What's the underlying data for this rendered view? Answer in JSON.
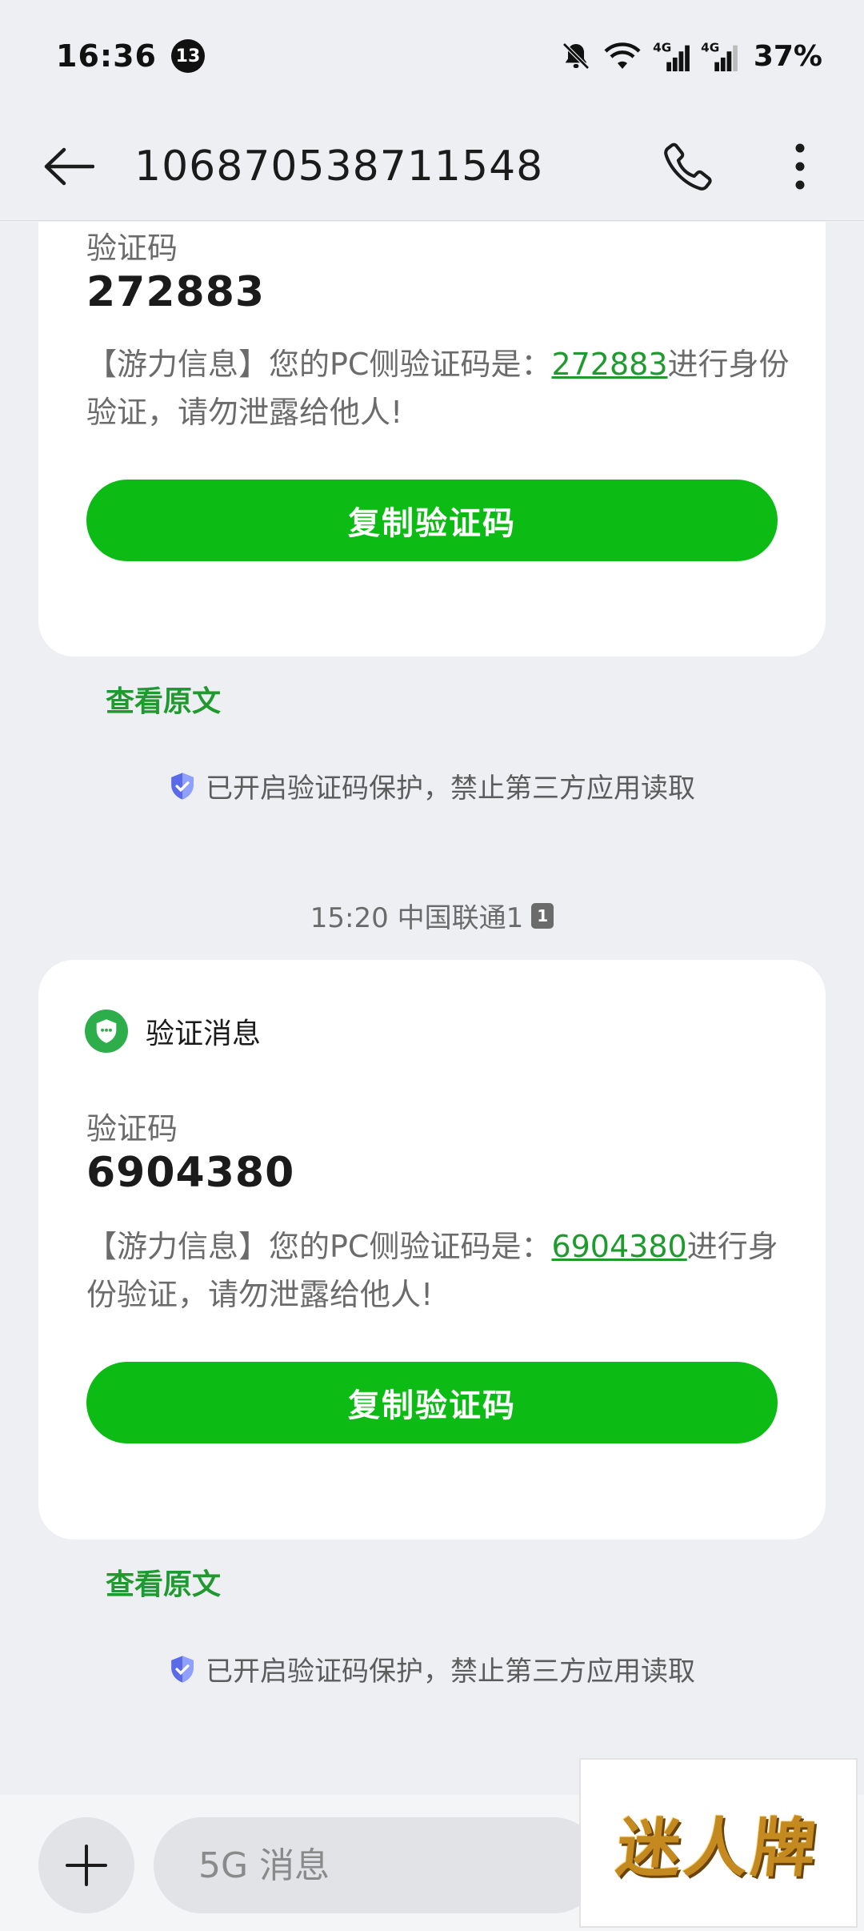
{
  "status_bar": {
    "time": "16:36",
    "notification_count": "13",
    "network_1": "4G",
    "network_2": "4G",
    "battery": "37%"
  },
  "header": {
    "title": "106870538711548"
  },
  "messages": [
    {
      "label": "验证码",
      "code": "272883",
      "text_before": "【游力信息】您的PC侧验证码是：",
      "text_code": "272883",
      "text_after": "进行身份验证，请勿泄露给他人!",
      "copy_label": "复制验证码",
      "view_original": "查看原文",
      "protection": "已开启验证码保护，禁止第三方应用读取"
    },
    {
      "timestamp": "15:20 中国联通1",
      "sim": "1",
      "card_title": "验证消息",
      "label": "验证码",
      "code": "6904380",
      "text_before": "【游力信息】您的PC侧验证码是：",
      "text_code": "6904380",
      "text_after": "进行身份验证，请勿泄露给他人!",
      "copy_label": "复制验证码",
      "view_original": "查看原文",
      "protection": "已开启验证码保护，禁止第三方应用读取"
    }
  ],
  "composer": {
    "placeholder": "5G 消息"
  },
  "watermark": {
    "text": "迷人牌"
  },
  "colors": {
    "accent_green": "#0cbb14",
    "link_green": "#1f9a2e",
    "background": "#eeeff2"
  }
}
